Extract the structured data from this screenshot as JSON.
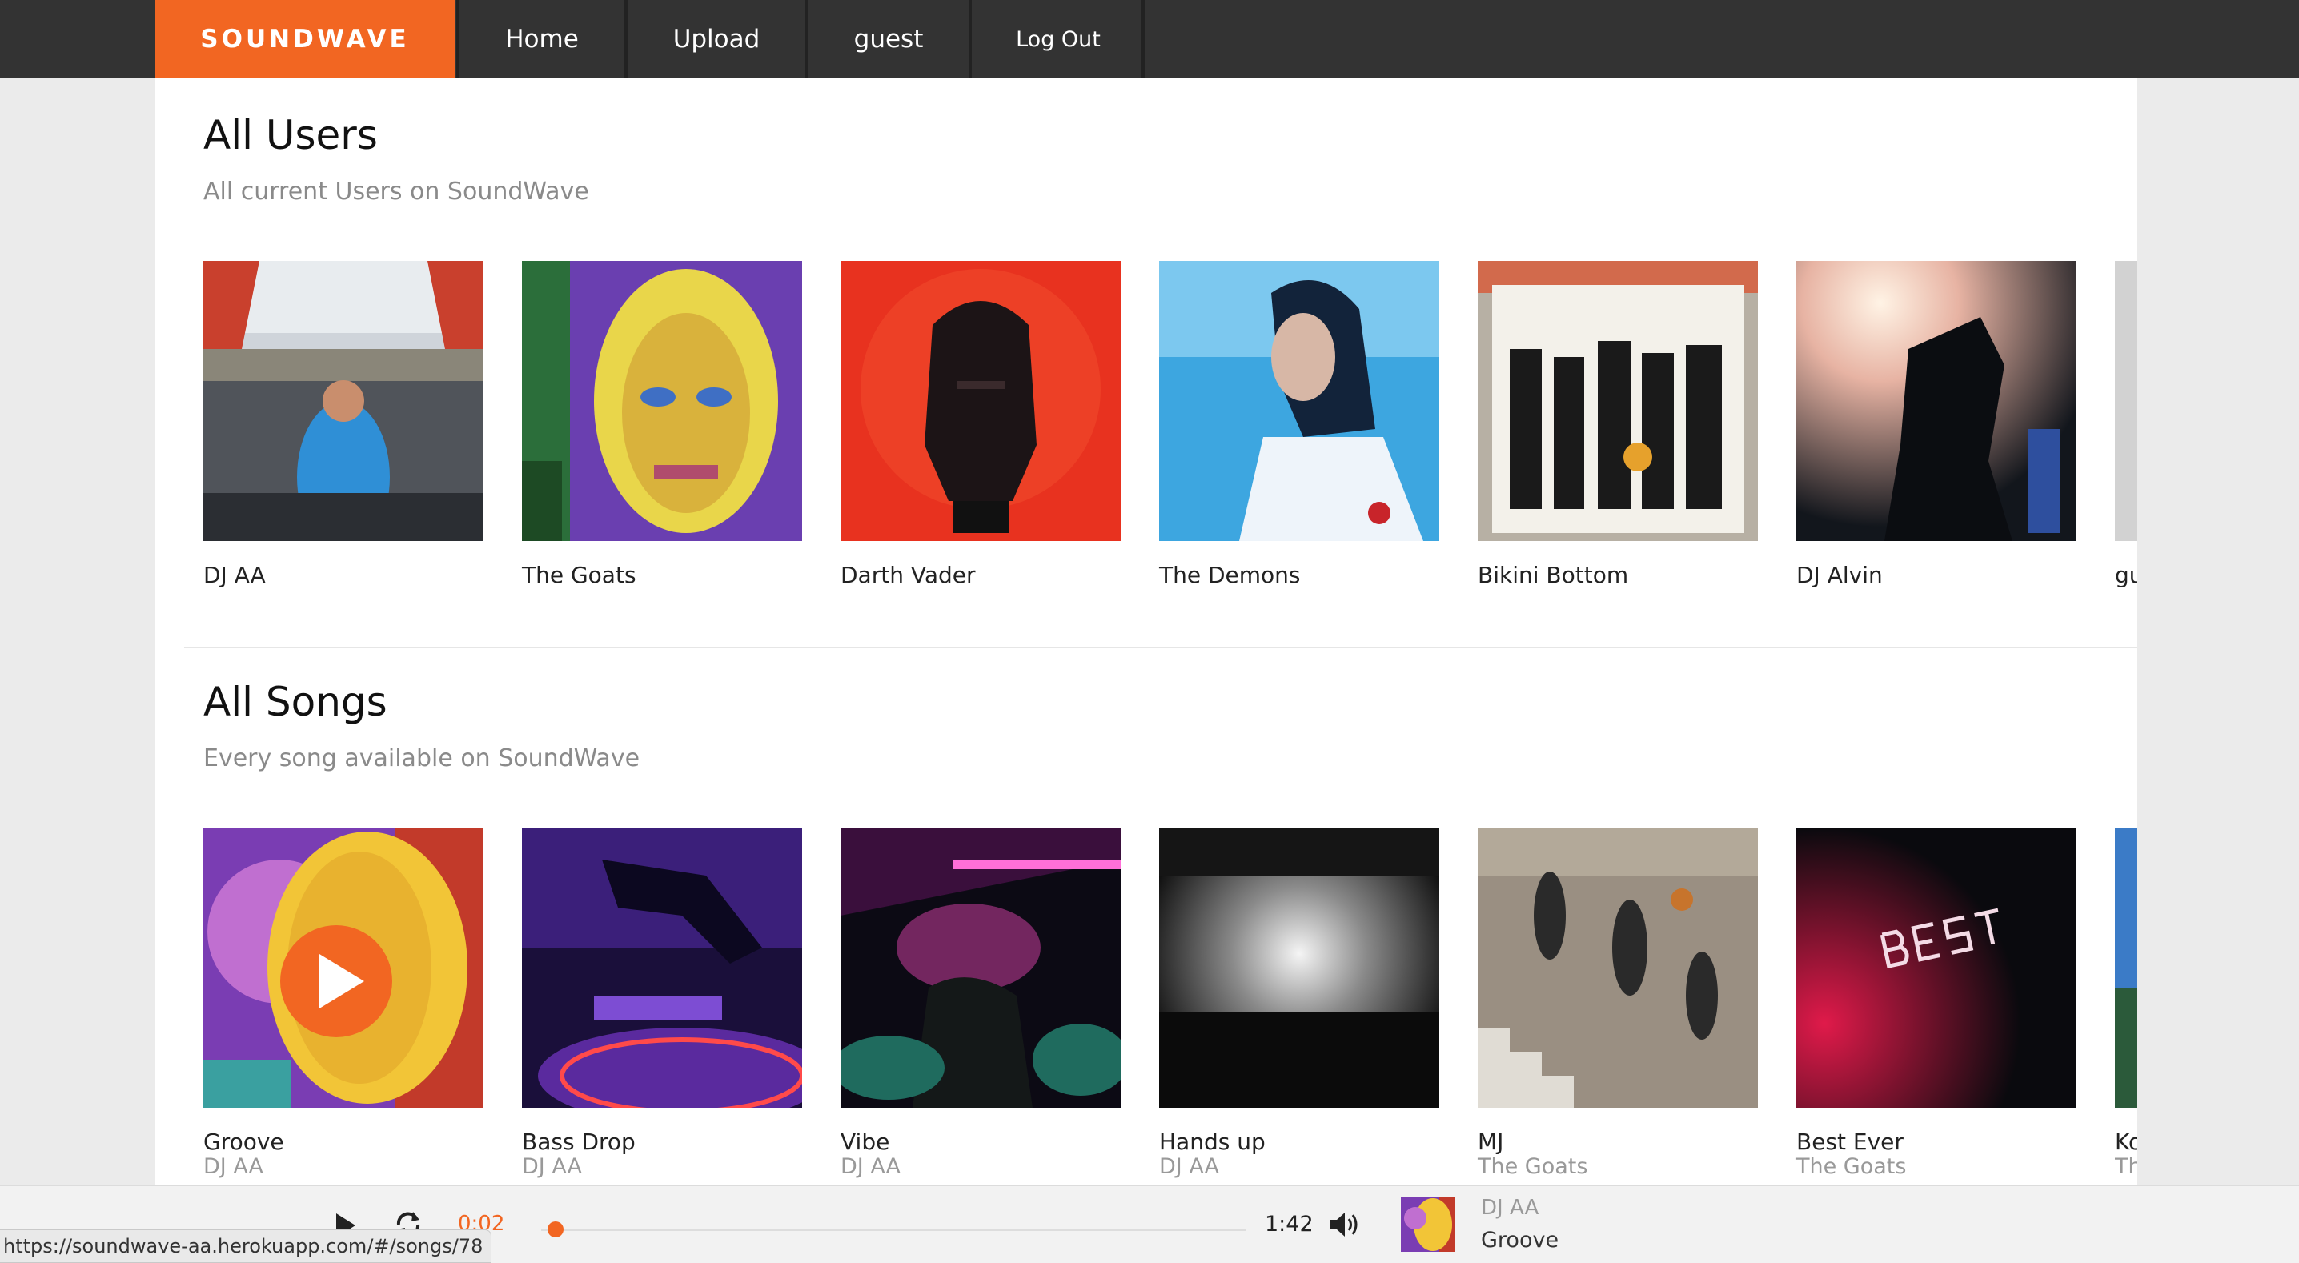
{
  "nav": {
    "brand": "SOUNDWAVE",
    "home": "Home",
    "upload": "Upload",
    "user": "guest",
    "logout": "Log Out"
  },
  "users_section": {
    "title": "All Users",
    "subtitle": "All current Users on SoundWave",
    "items": [
      {
        "name": "DJ AA"
      },
      {
        "name": "The Goats"
      },
      {
        "name": "Darth Vader"
      },
      {
        "name": "The Demons"
      },
      {
        "name": "Bikini Bottom"
      },
      {
        "name": "DJ Alvin"
      },
      {
        "name": "gu"
      }
    ]
  },
  "songs_section": {
    "title": "All Songs",
    "subtitle": "Every song available on SoundWave",
    "items": [
      {
        "title": "Groove",
        "artist": "DJ AA"
      },
      {
        "title": "Bass Drop",
        "artist": "DJ AA"
      },
      {
        "title": "Vibe",
        "artist": "DJ AA"
      },
      {
        "title": "Hands up",
        "artist": "DJ AA"
      },
      {
        "title": "MJ",
        "artist": "The Goats"
      },
      {
        "title": "Best Ever",
        "artist": "The Goats"
      },
      {
        "title": "Ko",
        "artist": "Th"
      }
    ]
  },
  "player": {
    "current_time": "0:02",
    "duration": "1:42",
    "progress_fraction": 0.02,
    "now_playing_artist": "DJ AA",
    "now_playing_title": "Groove",
    "icons": [
      "play-icon",
      "repeat-icon",
      "volume-icon"
    ]
  },
  "status_url": "https://soundwave-aa.herokuapp.com/#/songs/78",
  "colors": {
    "accent": "#f26622",
    "nav_bg": "#333333",
    "page_bg": "#ebebeb"
  }
}
